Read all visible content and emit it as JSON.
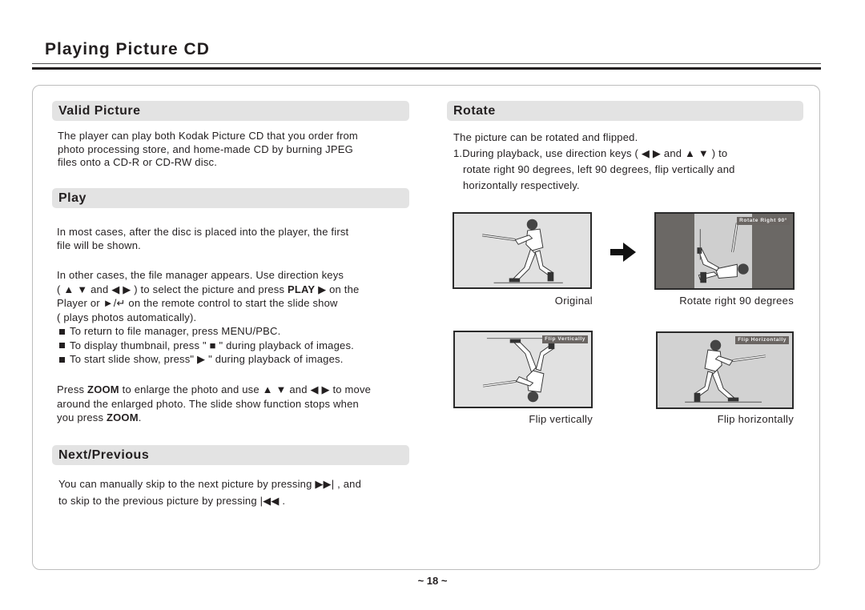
{
  "page": {
    "title": "Playing Picture CD",
    "page_number": "~ 18 ~"
  },
  "valid_picture": {
    "heading": "Valid Picture",
    "lines": [
      "The player can play both Kodak Picture CD that you order from",
      "photo processing store, and home-made CD by burning JPEG",
      "files onto a CD-R or CD-RW disc."
    ]
  },
  "play": {
    "heading": "Play",
    "para1": [
      "In most cases, after the disc is placed into the player, the first",
      "file will be shown."
    ],
    "para2": {
      "line1": "In other cases, the file manager appears. Use direction keys",
      "line2_a": "( ▲ ▼ and ◀ ▶ ) to select the picture and press ",
      "line2_bold": "PLAY",
      "line2_b": " ▶ on the",
      "line3": "Player or ►/↵ on the remote control to start the slide show",
      "line4": "( plays photos automatically)."
    },
    "bullets": [
      "To return to file manager, press MENU/PBC.",
      "To display thumbnail, press \" ■ \" during playback of images.",
      "To start slide show, press\" ▶ \" during playback of images."
    ],
    "zoom_para": {
      "l1_a": "Press ",
      "l1_bold": "ZOOM",
      "l1_b": " to enlarge the photo and use ▲ ▼ and ◀ ▶ to  move",
      "l2": "around the enlarged photo. The slide show function stops when",
      "l3_a": "you press ",
      "l3_bold": "ZOOM",
      "l3_b": "."
    }
  },
  "next_previous": {
    "heading": "Next/Previous",
    "line1": "You can manually skip to the next  picture by pressing ▶▶| , and",
    "line2": "to skip to the previous picture by pressing |◀◀ ."
  },
  "rotate": {
    "heading": "Rotate",
    "intro": "The picture can be rotated and flipped.",
    "step1_lines": [
      "1.During playback, use direction keys ( ◀ ▶ and ▲ ▼ ) to",
      "rotate right 90 degrees, left 90 degrees, flip vertically and",
      "horizontally respectively."
    ],
    "figures": [
      {
        "caption": "Original",
        "osd": ""
      },
      {
        "caption": "Rotate right 90 degrees",
        "osd": "Rotate Right 90°"
      },
      {
        "caption": "Flip vertically",
        "osd": "Flip Vertically"
      },
      {
        "caption": "Flip horizontally",
        "osd": "Flip Horizontally"
      }
    ],
    "arrow_icon": "right-arrow-icon"
  }
}
